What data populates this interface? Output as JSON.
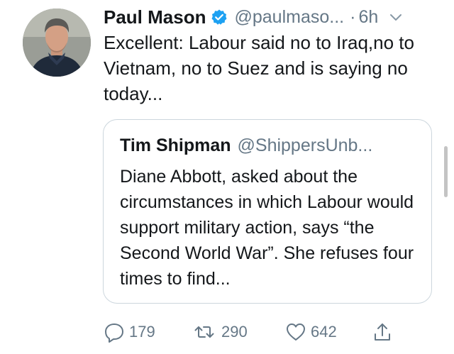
{
  "tweet": {
    "author_name": "Paul Mason",
    "handle": "@paulmaso...",
    "separator": "·",
    "time": "6h",
    "text": "Excellent: Labour said no to Iraq,no to Vietnam, no to Suez and is saying no today..."
  },
  "quoted": {
    "author_name": "Tim Shipman",
    "handle": "@ShippersUnb...",
    "text": "Diane Abbott, asked about the circumstances in which Labour would support military action, says “the Second World War”. She refuses four times to find..."
  },
  "actions": {
    "reply_count": "179",
    "retweet_count": "290",
    "like_count": "642"
  },
  "icons": {
    "verified": "verified-badge-icon",
    "chevron": "chevron-down-icon",
    "reply": "reply-icon",
    "retweet": "retweet-icon",
    "like": "heart-icon",
    "share": "share-icon"
  },
  "colors": {
    "text": "#14171a",
    "secondary": "#657786",
    "verified": "#1da1f2",
    "border": "#ccd6dd"
  }
}
